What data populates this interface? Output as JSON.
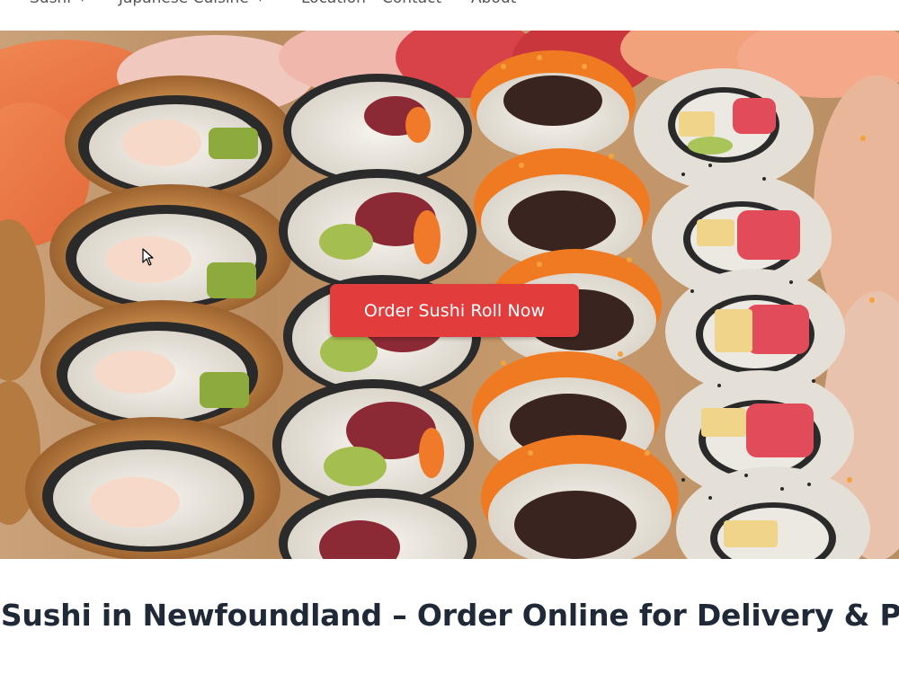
{
  "nav": {
    "items": [
      {
        "label": "Sushi",
        "has_dropdown": true
      },
      {
        "label": "Japanese Cuisine",
        "has_dropdown": true
      },
      {
        "label": "Location",
        "has_dropdown": false
      },
      {
        "label": "Contact",
        "has_dropdown": false
      },
      {
        "label": "About",
        "has_dropdown": false
      }
    ]
  },
  "hero": {
    "cta_label": "Order Sushi Roll Now",
    "cta_color": "#e23c3c"
  },
  "main": {
    "heading": "t Sushi in Newfoundland – Order Online for Delivery & Pi"
  }
}
